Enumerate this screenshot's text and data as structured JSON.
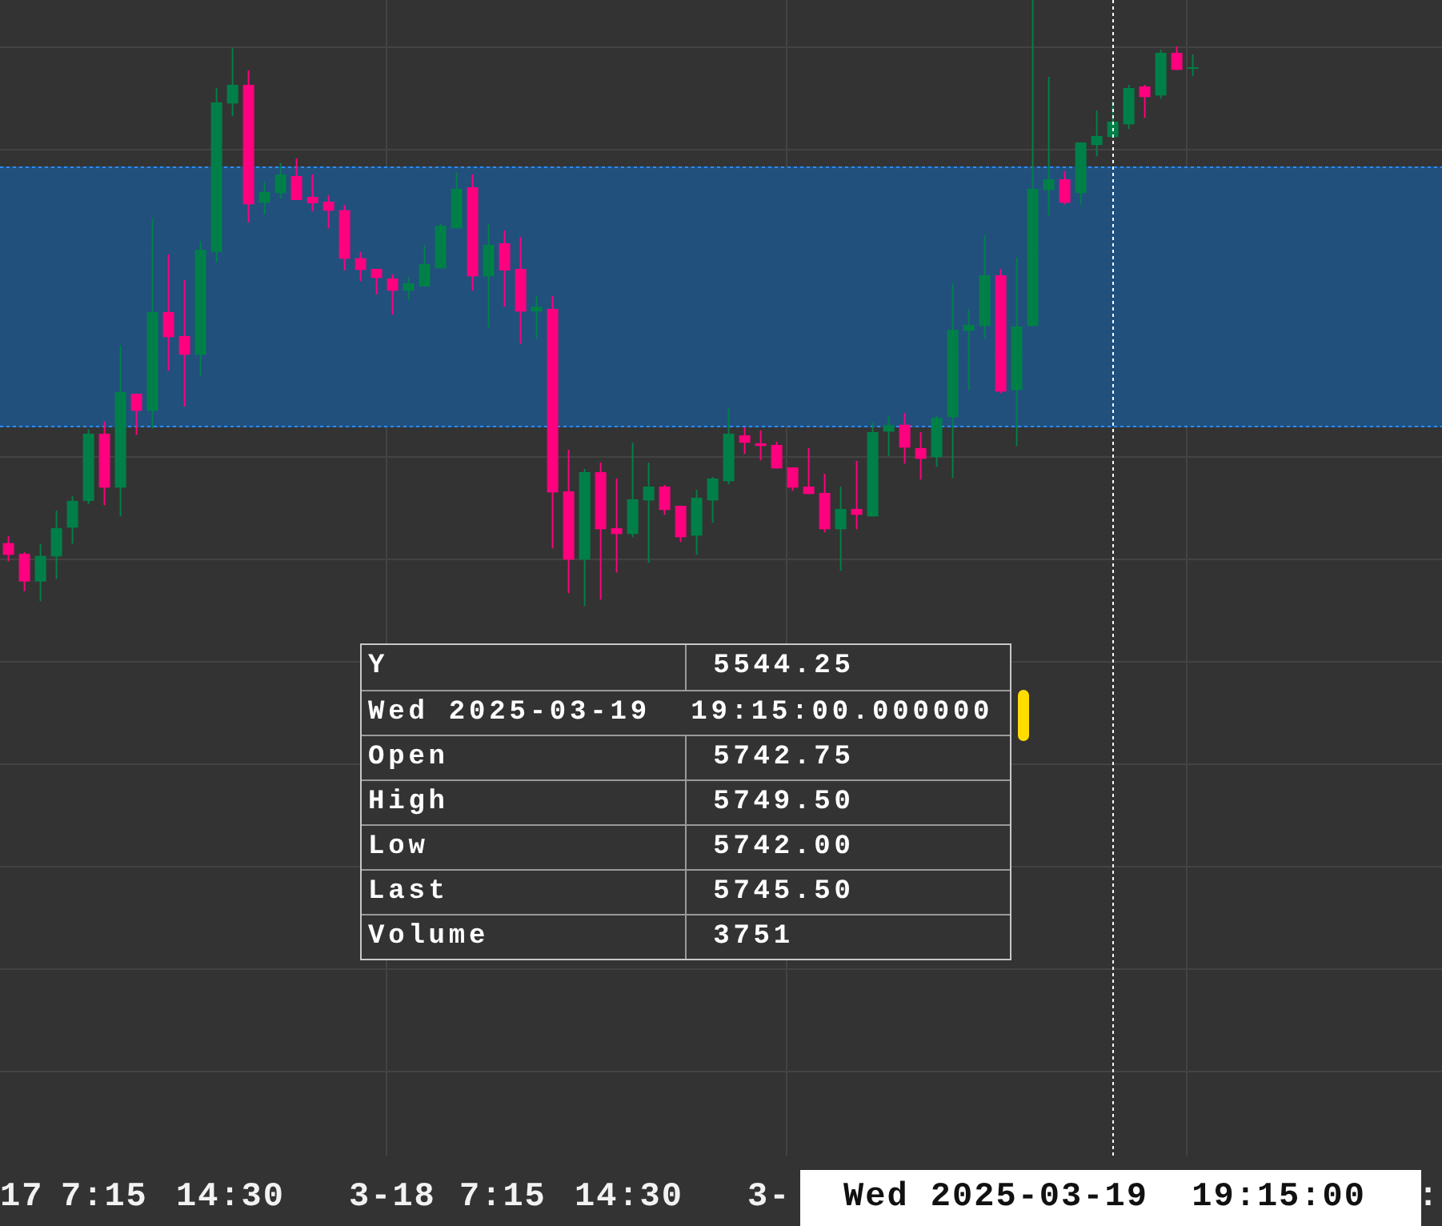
{
  "tooltip": {
    "rows": [
      {
        "kind": "pair",
        "label": "Y",
        "value": "5544.25"
      },
      {
        "kind": "span",
        "text": "Wed 2025-03-19  19:15:00.000000"
      },
      {
        "kind": "pair",
        "label": "Open",
        "value": "5742.75"
      },
      {
        "kind": "pair",
        "label": "High",
        "value": "5749.50"
      },
      {
        "kind": "pair",
        "label": "Low",
        "value": "5742.00"
      },
      {
        "kind": "pair",
        "label": "Last",
        "value": "5745.50"
      },
      {
        "kind": "pair",
        "label": "Volume",
        "value": "3751"
      }
    ]
  },
  "x_axis": {
    "labels": [
      "17",
      "7:15",
      "14:30",
      "3-18",
      "7:15",
      "14:30",
      "3-",
      ":"
    ],
    "crosshair_label": "Wed 2025-03-19  19:15:00"
  }
}
